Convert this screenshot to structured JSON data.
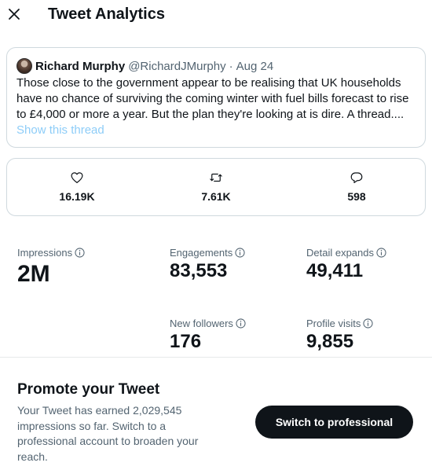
{
  "header": {
    "title": "Tweet Analytics",
    "close_icon": "close-icon"
  },
  "tweet": {
    "author_name": "Richard Murphy",
    "author_handle": "@RichardJMurphy",
    "separator": "·",
    "date": "Aug 24",
    "text": "Those close to the government appear to be realising that UK households have no chance of surviving the coming winter with fuel bills forecast to rise to £4,000 or more a year. But the plan they're looking at is dire. A thread....",
    "show_thread": "Show this thread"
  },
  "engagement_bar": {
    "likes": {
      "icon": "heart-icon",
      "value": "16.19K"
    },
    "retweets": {
      "icon": "retweet-icon",
      "value": "7.61K"
    },
    "replies": {
      "icon": "reply-icon",
      "value": "598"
    }
  },
  "stats": {
    "impressions": {
      "label": "Impressions",
      "value": "2M"
    },
    "engagements": {
      "label": "Engagements",
      "value": "83,553"
    },
    "detail_expands": {
      "label": "Detail expands",
      "value": "49,411"
    },
    "new_followers": {
      "label": "New followers",
      "value": "176"
    },
    "profile_visits": {
      "label": "Profile visits",
      "value": "9,855"
    }
  },
  "promo": {
    "title": "Promote your Tweet",
    "text": "Your Tweet has earned 2,029,545 impressions so far. Switch to a professional account to broaden your reach.",
    "button_label": "Switch to professional"
  },
  "colors": {
    "text_primary": "#0f1419",
    "text_secondary": "#536471",
    "link_muted": "#8ecdf8",
    "border": "#cfd9de",
    "button_bg": "#0f1419"
  }
}
